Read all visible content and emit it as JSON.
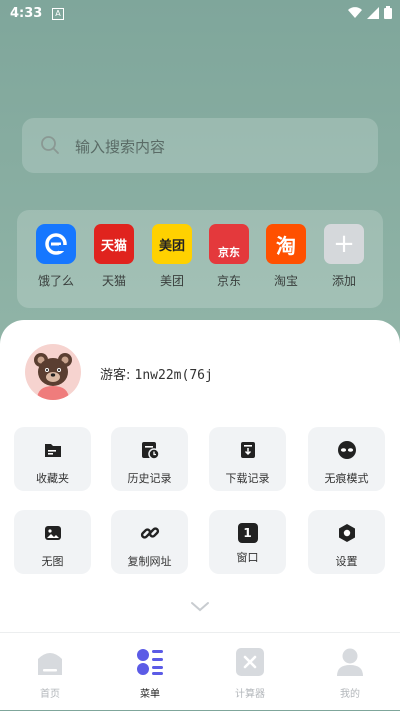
{
  "status": {
    "time": "4:33",
    "badge": "A"
  },
  "search": {
    "placeholder": "输入搜索内容"
  },
  "shortcuts": [
    {
      "label": "饿了么",
      "glyph": "e",
      "color": "#1677ff"
    },
    {
      "label": "天猫",
      "glyph": "天猫",
      "color": "#e0231e"
    },
    {
      "label": "美团",
      "glyph": "美团",
      "color": "#ffd100"
    },
    {
      "label": "京东",
      "glyph": "京东",
      "color": "#e4393c"
    },
    {
      "label": "淘宝",
      "glyph": "淘",
      "color": "#ff5000"
    },
    {
      "label": "添加",
      "glyph": "+",
      "color": "#d5d8db"
    }
  ],
  "user": {
    "prefix": "游客:",
    "name": "1nw22m(76j"
  },
  "menu": [
    {
      "label": "收藏夹",
      "icon": "folder-icon"
    },
    {
      "label": "历史记录",
      "icon": "history-icon"
    },
    {
      "label": "下载记录",
      "icon": "download-icon"
    },
    {
      "label": "无痕模式",
      "icon": "incognito-icon"
    },
    {
      "label": "无图",
      "icon": "no-image-icon"
    },
    {
      "label": "复制网址",
      "icon": "link-icon"
    },
    {
      "label": "窗口",
      "icon": "window-icon",
      "count": "1"
    },
    {
      "label": "设置",
      "icon": "settings-icon"
    }
  ],
  "tabs": [
    {
      "label": "首页",
      "icon": "home-icon"
    },
    {
      "label": "菜单",
      "icon": "menu-icon"
    },
    {
      "label": "计算器",
      "icon": "calculator-icon"
    },
    {
      "label": "我的",
      "icon": "profile-icon"
    }
  ],
  "colors": {
    "accent": "#5b5be6",
    "dark_icon": "#222222"
  }
}
